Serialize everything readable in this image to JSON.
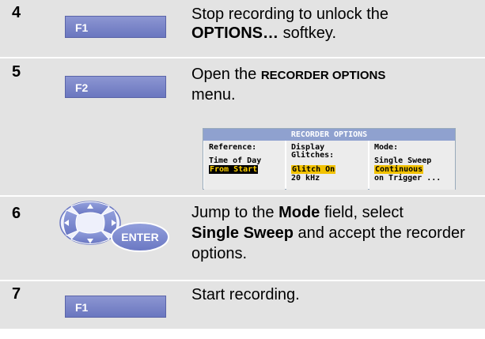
{
  "steps": [
    {
      "number": "4",
      "key": "F1",
      "text_parts": [
        "Stop recording to unlock the ",
        "OPTIONS…",
        " softkey."
      ]
    },
    {
      "number": "5",
      "key": "F2",
      "text_parts": [
        "Open the ",
        "RECORDER OPTIONS",
        " menu."
      ]
    },
    {
      "number": "6",
      "key": "ENTER",
      "text_parts": [
        "Jump to the ",
        "Mode",
        " field, select ",
        "Single Sweep",
        " and accept the recorder options."
      ]
    },
    {
      "number": "7",
      "key": "F1",
      "text_parts": [
        "Start recording."
      ]
    }
  ],
  "recorder_options": {
    "title": "RECORDER OPTIONS",
    "reference": {
      "label": "Reference:",
      "options": [
        "Time of Day",
        "From Start"
      ],
      "selected": "From Start"
    },
    "display_glitches": {
      "label_line1": "Display",
      "label_line2": "Glitches:",
      "options": [
        "Glitch On",
        "20 kHz"
      ],
      "selected": "Glitch On"
    },
    "mode": {
      "label": "Mode:",
      "options": [
        "Single Sweep",
        "Continuous",
        "on Trigger ..."
      ],
      "selected": "Continuous"
    }
  },
  "colors": {
    "row_bg": "#e3e3e3",
    "softkey": "#7a85c8",
    "title_bar": "#8fa1cf",
    "highlight": "#f2c200"
  }
}
